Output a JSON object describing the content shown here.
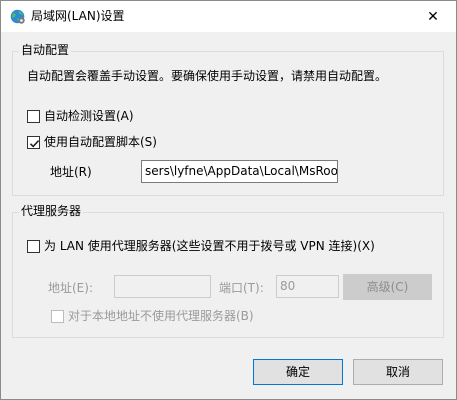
{
  "window": {
    "title": "局域网(LAN)设置",
    "icon": "globe-settings-icon",
    "close_symbol": "✕"
  },
  "auto_config": {
    "legend": "自动配置",
    "description": "自动配置会覆盖手动设置。要确保使用手动设置，请禁用自动配置。",
    "auto_detect": {
      "label": "自动检测设置(A)",
      "checked": false
    },
    "use_script": {
      "label": "使用自动配置脚本(S)",
      "checked": true
    },
    "address_label": "地址(R)",
    "address_value": "sers\\lyfne\\AppData\\Local\\MsRoot.pac"
  },
  "proxy": {
    "legend": "代理服务器",
    "use_proxy": {
      "label": "为 LAN 使用代理服务器(这些设置不用于拨号或 VPN 连接)(X)",
      "checked": false
    },
    "address_label": "地址(E):",
    "address_value": "",
    "port_label": "端口(T):",
    "port_value": "80",
    "advanced_label": "高级(C)",
    "bypass_local": {
      "label": "对于本地地址不使用代理服务器(B)",
      "checked": false
    }
  },
  "buttons": {
    "ok_label": "确定",
    "cancel_label": "取消"
  },
  "colors": {
    "accent": "#0078d7",
    "disabled_text": "#9a9a9a",
    "dialog_bg": "#f0f0f0"
  }
}
